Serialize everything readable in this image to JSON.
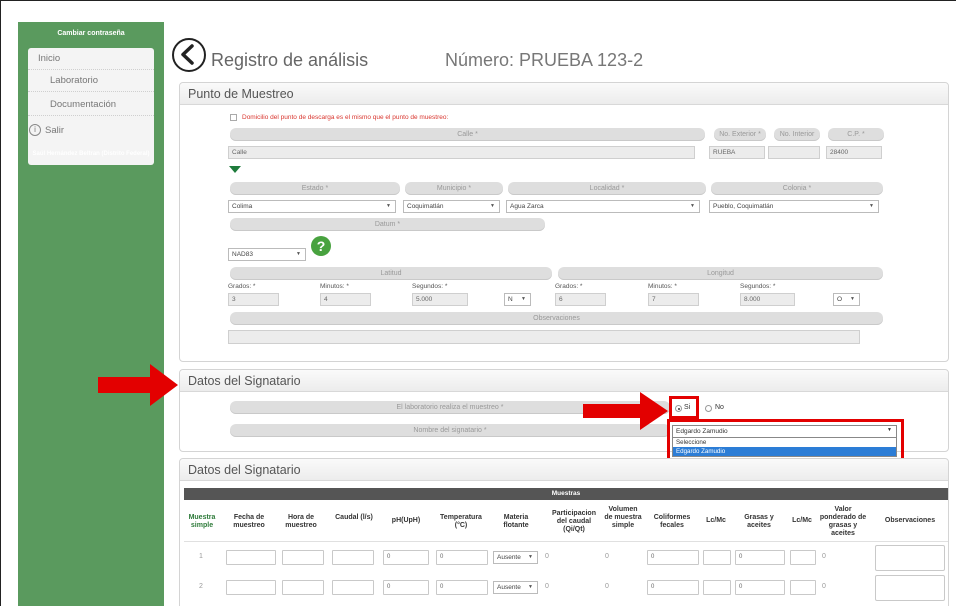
{
  "sidebar": {
    "change_password": "Cambiar contraseña",
    "items": [
      {
        "label": "Inicio"
      },
      {
        "label": "Laboratorio"
      },
      {
        "label": "Documentación"
      },
      {
        "label": "Salir"
      }
    ],
    "user": "Saúl Hernández Beltran (Distrito Federal)"
  },
  "header": {
    "title": "Registro de análisis",
    "number": "Número: PRUEBA 123-2"
  },
  "punto": {
    "heading": "Punto de Muestreo",
    "same_address": "Domicilio del punto de descarga es el mismo que el punto de muestreo:",
    "calle_label": "Calle *",
    "calle_value": "Calle",
    "no_ext_label": "No. Exterior *",
    "no_ext_value": "RUEBA",
    "no_int_label": "No. Interior",
    "no_int_value": "",
    "cp_label": "C.P. *",
    "cp_value": "28400",
    "estado_label": "Estado *",
    "estado_value": "Colima",
    "municipio_label": "Municipio *",
    "municipio_value": "Coquimatlán",
    "localidad_label": "Localidad *",
    "localidad_value": "Agua Zarca",
    "colonia_label": "Colonia *",
    "colonia_value": "Pueblo, Coquimatlán",
    "datum_label": "Datum *",
    "datum_value": "NAD83",
    "help": "?",
    "latitud_label": "Latitud",
    "longitud_label": "Longitud",
    "grados_label": "Grados: *",
    "minutos_label": "Minutos: *",
    "segundos_label": "Segundos: *",
    "lat_grados": "3",
    "lat_minutos": "4",
    "lat_segundos": "5.000",
    "lat_dir": "N",
    "lon_grados": "6",
    "lon_minutos": "7",
    "lon_segundos": "8.000",
    "lon_dir": "O",
    "observaciones_label": "Observaciones"
  },
  "signatario": {
    "heading": "Datos del Signatario",
    "lab_question": "El laboratorio realiza el muestreo *",
    "opt_si": "Si",
    "opt_no": "No",
    "nombre_label": "Nombre del signatario *",
    "selected": "Edgardo Zamudio",
    "options": [
      "Seleccione",
      "Edgardo Zamudio"
    ]
  },
  "muestras": {
    "heading": "Datos del Signatario",
    "bar": "Muestras",
    "columns": [
      "Muestra simple",
      "Fecha de muestreo",
      "Hora de muestreo",
      "Caudal (l/s)",
      "pH(UpH)",
      "Temperatura (°C)",
      "Materia flotante",
      "Participacion del caudal (Qi/Qt)",
      "Volumen de muestra simple",
      "Coliformes fecales",
      "Lc/Mc",
      "Grasas y aceites",
      "Lc/Mc",
      "Valor ponderado de grasas y aceites",
      "Observaciones"
    ],
    "rows": [
      {
        "n": "1",
        "ph": "0",
        "temp": "0",
        "materia": "Ausente",
        "part": "0",
        "vol": "0",
        "coli": "0",
        "grasas": "0",
        "valor": "0"
      },
      {
        "n": "2",
        "ph": "0",
        "temp": "0",
        "materia": "Ausente",
        "part": "0",
        "vol": "0",
        "coli": "0",
        "grasas": "0",
        "valor": "0"
      }
    ]
  },
  "colors": {
    "sidebar": "#5a9a5e",
    "accent_green": "#2e7b3a",
    "annotation_red": "#e30000"
  }
}
